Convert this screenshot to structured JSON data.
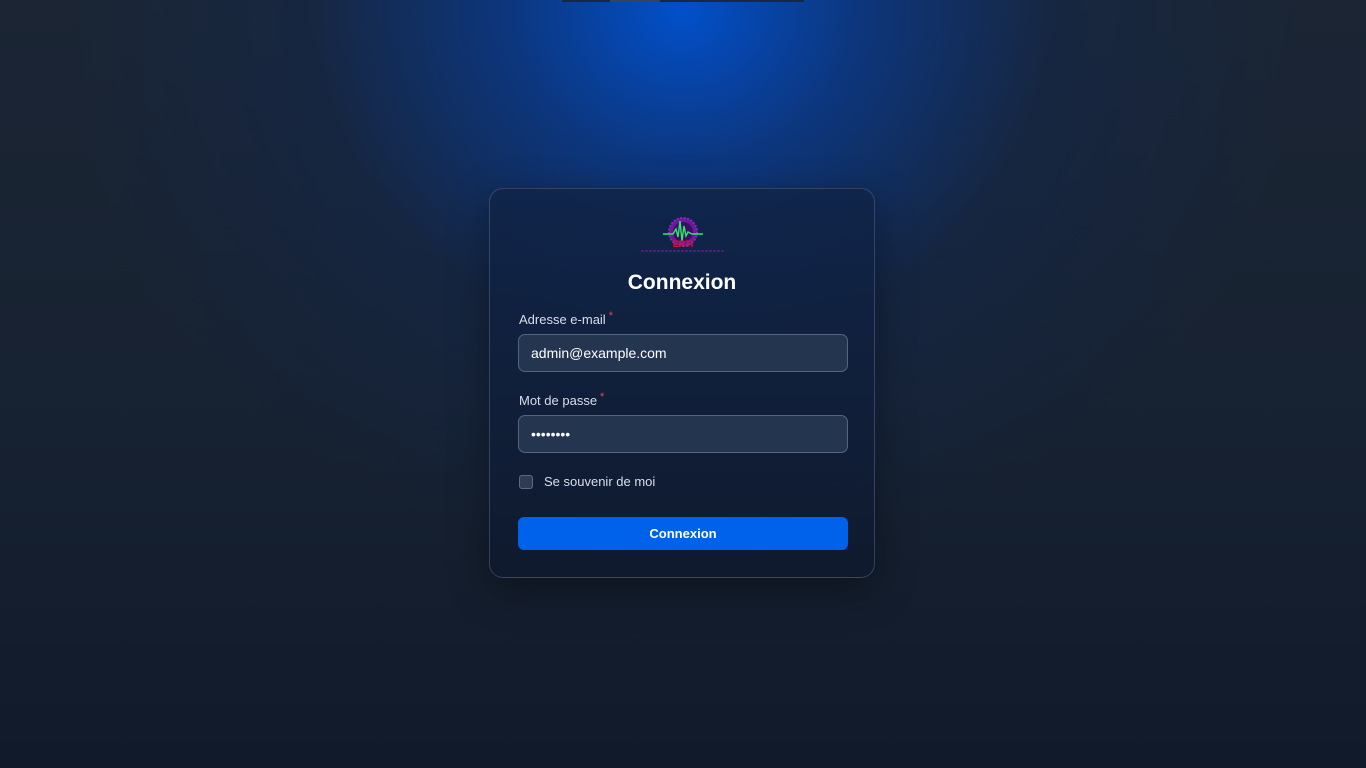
{
  "form": {
    "title": "Connexion",
    "email": {
      "label": "Adresse e-mail",
      "required_mark": "*",
      "value": "admin@example.com"
    },
    "password": {
      "label": "Mot de passe",
      "required_mark": "*",
      "value": "••••••••"
    },
    "remember": {
      "label": "Se souvenir de moi",
      "checked": false
    },
    "submit_label": "Connexion"
  },
  "logo": {
    "text": "ERTI",
    "icon": "company-logo-icon"
  },
  "colors": {
    "accent": "#0062ea",
    "required": "#ef4444",
    "field_bg": "#24354f",
    "card_bg": "#0f1a2e"
  }
}
